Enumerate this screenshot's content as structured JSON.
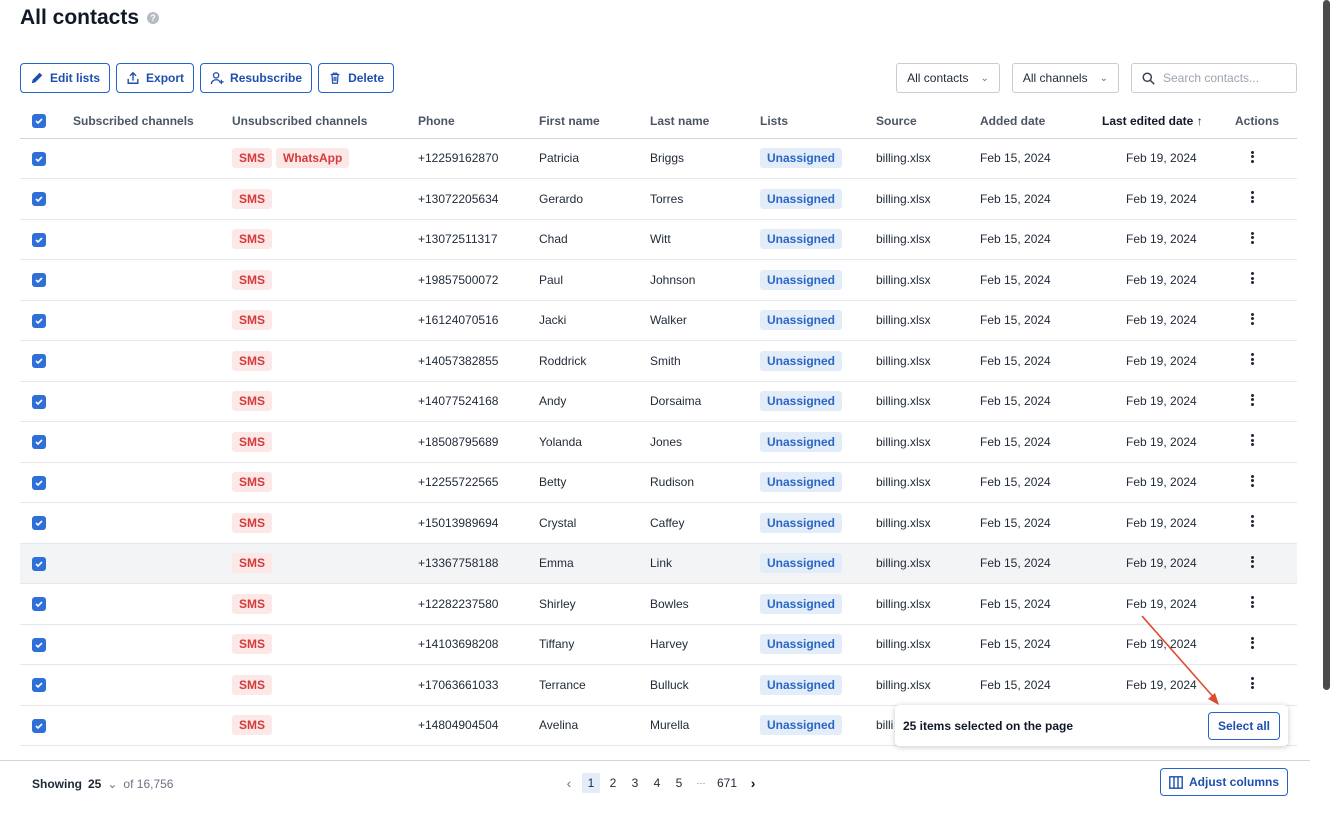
{
  "page": {
    "title": "All contacts",
    "help_glyph": "?"
  },
  "toolbar": {
    "edit_lists": "Edit lists",
    "export": "Export",
    "resubscribe": "Resubscribe",
    "delete": "Delete"
  },
  "filters": {
    "contacts_select": "All contacts",
    "channels_select": "All channels",
    "search_placeholder": "Search contacts..."
  },
  "table": {
    "headers": {
      "subscribed": "Subscribed channels",
      "unsubscribed": "Unsubscribed channels",
      "phone": "Phone",
      "first_name": "First name",
      "last_name": "Last name",
      "lists": "Lists",
      "source": "Source",
      "added": "Added date",
      "last_edited": "Last edited date",
      "sort_glyph": "↑",
      "actions": "Actions"
    },
    "rows": [
      {
        "unsub": [
          "SMS",
          "WhatsApp"
        ],
        "phone": "+12259162870",
        "first": "Patricia",
        "last": "Briggs",
        "list": "Unassigned",
        "source": "billing.xlsx",
        "added": "Feb 15, 2024",
        "edited": "Feb 19, 2024"
      },
      {
        "unsub": [
          "SMS"
        ],
        "phone": "+13072205634",
        "first": "Gerardo",
        "last": "Torres",
        "list": "Unassigned",
        "source": "billing.xlsx",
        "added": "Feb 15, 2024",
        "edited": "Feb 19, 2024"
      },
      {
        "unsub": [
          "SMS"
        ],
        "phone": "+13072511317",
        "first": "Chad",
        "last": "Witt",
        "list": "Unassigned",
        "source": "billing.xlsx",
        "added": "Feb 15, 2024",
        "edited": "Feb 19, 2024"
      },
      {
        "unsub": [
          "SMS"
        ],
        "phone": "+19857500072",
        "first": "Paul",
        "last": "Johnson",
        "list": "Unassigned",
        "source": "billing.xlsx",
        "added": "Feb 15, 2024",
        "edited": "Feb 19, 2024"
      },
      {
        "unsub": [
          "SMS"
        ],
        "phone": "+16124070516",
        "first": "Jacki",
        "last": "Walker",
        "list": "Unassigned",
        "source": "billing.xlsx",
        "added": "Feb 15, 2024",
        "edited": "Feb 19, 2024"
      },
      {
        "unsub": [
          "SMS"
        ],
        "phone": "+14057382855",
        "first": "Roddrick",
        "last": "Smith",
        "list": "Unassigned",
        "source": "billing.xlsx",
        "added": "Feb 15, 2024",
        "edited": "Feb 19, 2024"
      },
      {
        "unsub": [
          "SMS"
        ],
        "phone": "+14077524168",
        "first": "Andy",
        "last": "Dorsaima",
        "list": "Unassigned",
        "source": "billing.xlsx",
        "added": "Feb 15, 2024",
        "edited": "Feb 19, 2024"
      },
      {
        "unsub": [
          "SMS"
        ],
        "phone": "+18508795689",
        "first": "Yolanda",
        "last": "Jones",
        "list": "Unassigned",
        "source": "billing.xlsx",
        "added": "Feb 15, 2024",
        "edited": "Feb 19, 2024"
      },
      {
        "unsub": [
          "SMS"
        ],
        "phone": "+12255722565",
        "first": "Betty",
        "last": "Rudison",
        "list": "Unassigned",
        "source": "billing.xlsx",
        "added": "Feb 15, 2024",
        "edited": "Feb 19, 2024"
      },
      {
        "unsub": [
          "SMS"
        ],
        "phone": "+15013989694",
        "first": "Crystal",
        "last": "Caffey",
        "list": "Unassigned",
        "source": "billing.xlsx",
        "added": "Feb 15, 2024",
        "edited": "Feb 19, 2024"
      },
      {
        "unsub": [
          "SMS"
        ],
        "phone": "+13367758188",
        "first": "Emma",
        "last": "Link",
        "list": "Unassigned",
        "source": "billing.xlsx",
        "added": "Feb 15, 2024",
        "edited": "Feb 19, 2024",
        "highlight": true
      },
      {
        "unsub": [
          "SMS"
        ],
        "phone": "+12282237580",
        "first": "Shirley",
        "last": "Bowles",
        "list": "Unassigned",
        "source": "billing.xlsx",
        "added": "Feb 15, 2024",
        "edited": "Feb 19, 2024"
      },
      {
        "unsub": [
          "SMS"
        ],
        "phone": "+14103698208",
        "first": "Tiffany",
        "last": "Harvey",
        "list": "Unassigned",
        "source": "billing.xlsx",
        "added": "Feb 15, 2024",
        "edited": "Feb 19, 2024"
      },
      {
        "unsub": [
          "SMS"
        ],
        "phone": "+17063661033",
        "first": "Terrance",
        "last": "Bulluck",
        "list": "Unassigned",
        "source": "billing.xlsx",
        "added": "Feb 15, 2024",
        "edited": "Feb 19, 2024"
      },
      {
        "unsub": [
          "SMS"
        ],
        "phone": "+14804904504",
        "first": "Avelina",
        "last": "Murella",
        "list": "Unassigned",
        "source": "billi",
        "added": "",
        "edited": ""
      }
    ]
  },
  "selection_popup": {
    "text": "25 items selected on the page",
    "button": "Select all"
  },
  "footer": {
    "showing_label": "Showing",
    "page_size": "25",
    "total": "of 16,756",
    "pages": [
      "1",
      "2",
      "3",
      "4",
      "5"
    ],
    "ellipsis": "···",
    "last_page": "671",
    "prev": "‹",
    "next": "›",
    "adjust_columns": "Adjust columns"
  },
  "colors": {
    "accent": "#2f6fd8",
    "unsub_badge": "#d43a3a",
    "list_badge": "#2b66c4"
  }
}
